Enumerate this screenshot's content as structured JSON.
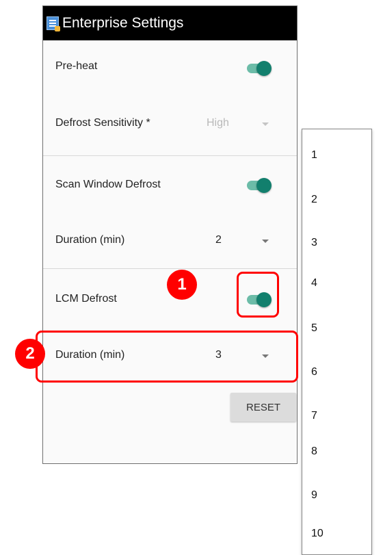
{
  "app": {
    "title": "Enterprise Settings",
    "icon": "settings-app-icon"
  },
  "settings": {
    "preheat": {
      "label": "Pre-heat",
      "enabled": true
    },
    "defrost_sensitivity": {
      "label": "Defrost Sensitivity *",
      "value": "High",
      "disabled": true
    },
    "scan_window_defrost": {
      "label": "Scan Window Defrost",
      "enabled": true
    },
    "scan_duration": {
      "label": "Duration (min)",
      "value": "2"
    },
    "lcm_defrost": {
      "label": "LCM Defrost",
      "enabled": true
    },
    "lcm_duration": {
      "label": "Duration (min)",
      "value": "3"
    }
  },
  "reset_label": "RESET",
  "duration_options": [
    "1",
    "2",
    "3",
    "4",
    "5",
    "6",
    "7",
    "8",
    "9",
    "10"
  ],
  "annotations": {
    "badge1": "1",
    "badge2": "2",
    "color": "#ff0000"
  },
  "colors": {
    "toggle_on_knob": "#127f6d",
    "toggle_on_track": "#6cbca8",
    "titlebar": "#000000"
  }
}
